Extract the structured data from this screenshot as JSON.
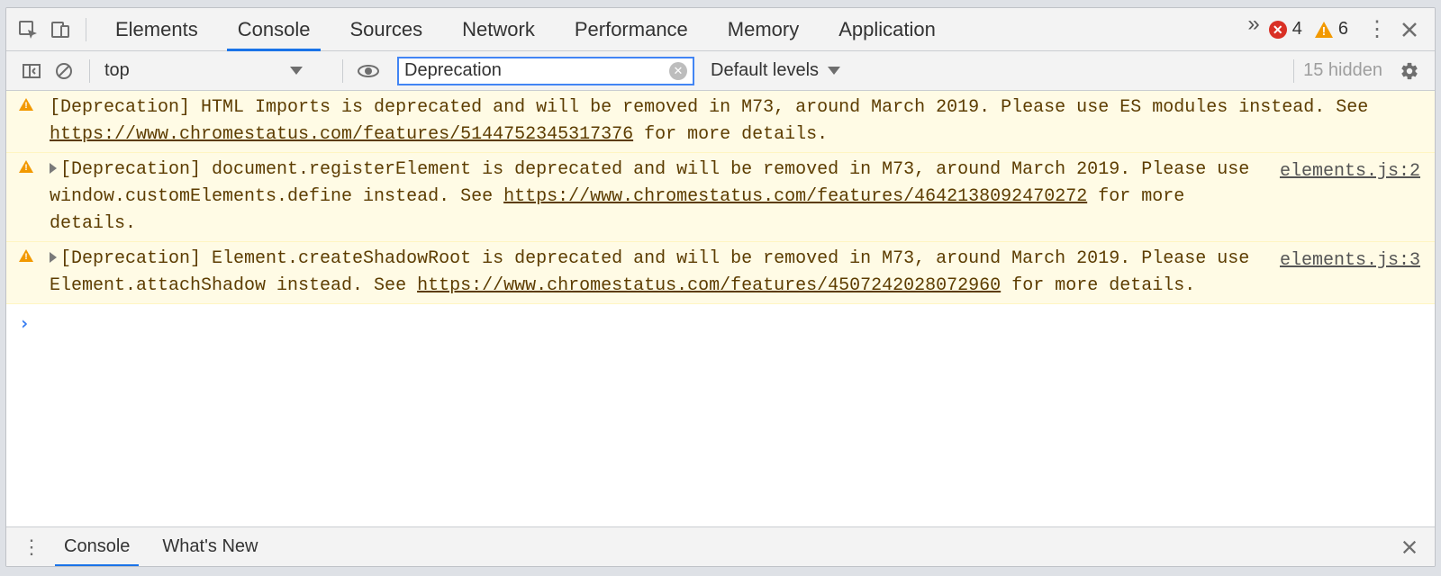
{
  "header": {
    "tabs": [
      "Elements",
      "Console",
      "Sources",
      "Network",
      "Performance",
      "Memory",
      "Application"
    ],
    "active_tab": "Console",
    "errors_count": "4",
    "warnings_count": "6"
  },
  "toolbar": {
    "context_label": "top",
    "filter_value": "Deprecation",
    "levels_label": "Default levels",
    "hidden_label": "15 hidden"
  },
  "messages": [
    {
      "expandable": false,
      "text_a": "[Deprecation] HTML Imports is deprecated and will be removed in M73, around March 2019. Please use ES modules instead. See ",
      "link": "https://www.chromestatus.com/features/5144752345317376",
      "text_b": " for more details.",
      "source": ""
    },
    {
      "expandable": true,
      "text_a": "[Deprecation] document.registerElement is deprecated and will be removed in M73, around March 2019. Please use window.customElements.define instead. See ",
      "link": "https://www.chromestatus.com/features/4642138092470272",
      "text_b": " for more details.",
      "source": "elements.js:2"
    },
    {
      "expandable": true,
      "text_a": "[Deprecation] Element.createShadowRoot is deprecated and will be removed in M73, around March 2019. Please use Element.attachShadow instead. See ",
      "link": "https://www.chromestatus.com/features/4507242028072960",
      "text_b": " for more details.",
      "source": "elements.js:3"
    }
  ],
  "drawer": {
    "tabs": [
      "Console",
      "What's New"
    ],
    "active_tab": "Console"
  }
}
